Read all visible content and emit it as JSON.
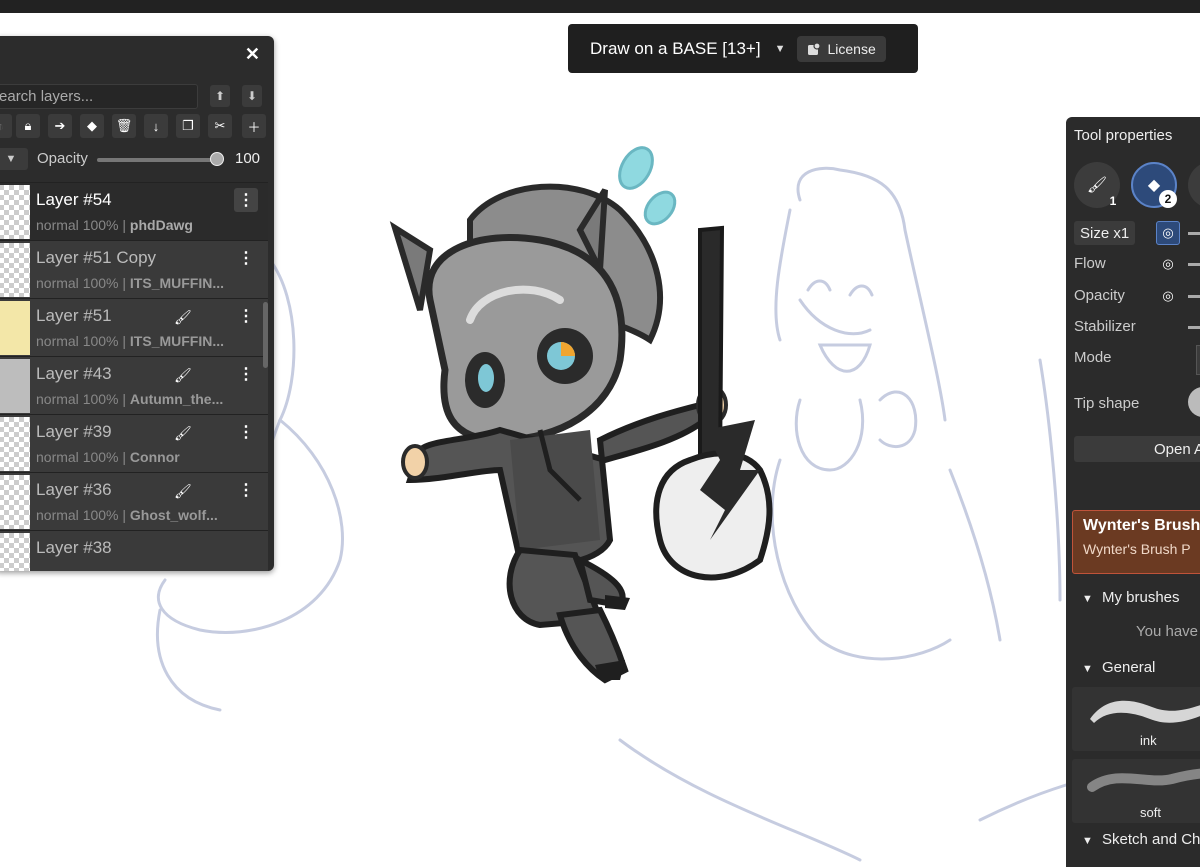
{
  "document": {
    "title": "Draw on a BASE [13+]",
    "license_label": "License"
  },
  "layers_panel": {
    "search_placeholder": "Search layers...",
    "opacity_label": "Opacity",
    "opacity_value": "100",
    "close_icon": "close-icon",
    "layers": [
      {
        "name": "Layer #54",
        "blend": "normal",
        "opacity": "100%",
        "separator": "|",
        "owner": "phdDawg",
        "selected": true,
        "brush": false
      },
      {
        "name": "Layer #51 Copy",
        "blend": "normal",
        "opacity": "100%",
        "separator": "|",
        "owner": "ITS_MUFFIN...",
        "selected": false,
        "brush": false
      },
      {
        "name": "Layer #51",
        "blend": "normal",
        "opacity": "100%",
        "separator": "|",
        "owner": "ITS_MUFFIN...",
        "selected": false,
        "brush": true
      },
      {
        "name": "Layer #43",
        "blend": "normal",
        "opacity": "100%",
        "separator": "|",
        "owner": "Autumn_the...",
        "selected": false,
        "brush": true
      },
      {
        "name": "Layer #39",
        "blend": "normal",
        "opacity": "100%",
        "separator": "|",
        "owner": "Connor",
        "selected": false,
        "brush": true
      },
      {
        "name": "Layer #36",
        "blend": "normal",
        "opacity": "100%",
        "separator": "|",
        "owner": "Ghost_wolf...",
        "selected": false,
        "brush": true
      },
      {
        "name": "Layer #38",
        "blend": "",
        "opacity": "",
        "separator": "",
        "owner": "",
        "selected": false,
        "brush": false
      }
    ]
  },
  "tool_properties": {
    "title": "Tool properties",
    "tool_slots": [
      {
        "icon": "brush-icon",
        "badge": "1"
      },
      {
        "icon": "eraser-icon",
        "badge": "2"
      }
    ],
    "size_label": "Size x1",
    "flow_label": "Flow",
    "opacity_label": "Opacity",
    "stabilizer_label": "Stabilizer",
    "mode_label": "Mode",
    "tip_shape_label": "Tip shape",
    "open_button": "Open A",
    "banner_title": "Wynter's Brush",
    "banner_subtitle": "Wynter's Brush P",
    "sections": {
      "my_brushes": "My brushes",
      "my_brushes_empty": "You have",
      "general": "General",
      "sketch": "Sketch and Ch"
    },
    "brushes": [
      "ink",
      "soft"
    ]
  },
  "colors": {
    "panel_bg": "#2c2c2c",
    "accent_blue": "#2d4a7a",
    "banner_bg": "#6b3a22",
    "sketch_stroke": "#c6cce0"
  }
}
